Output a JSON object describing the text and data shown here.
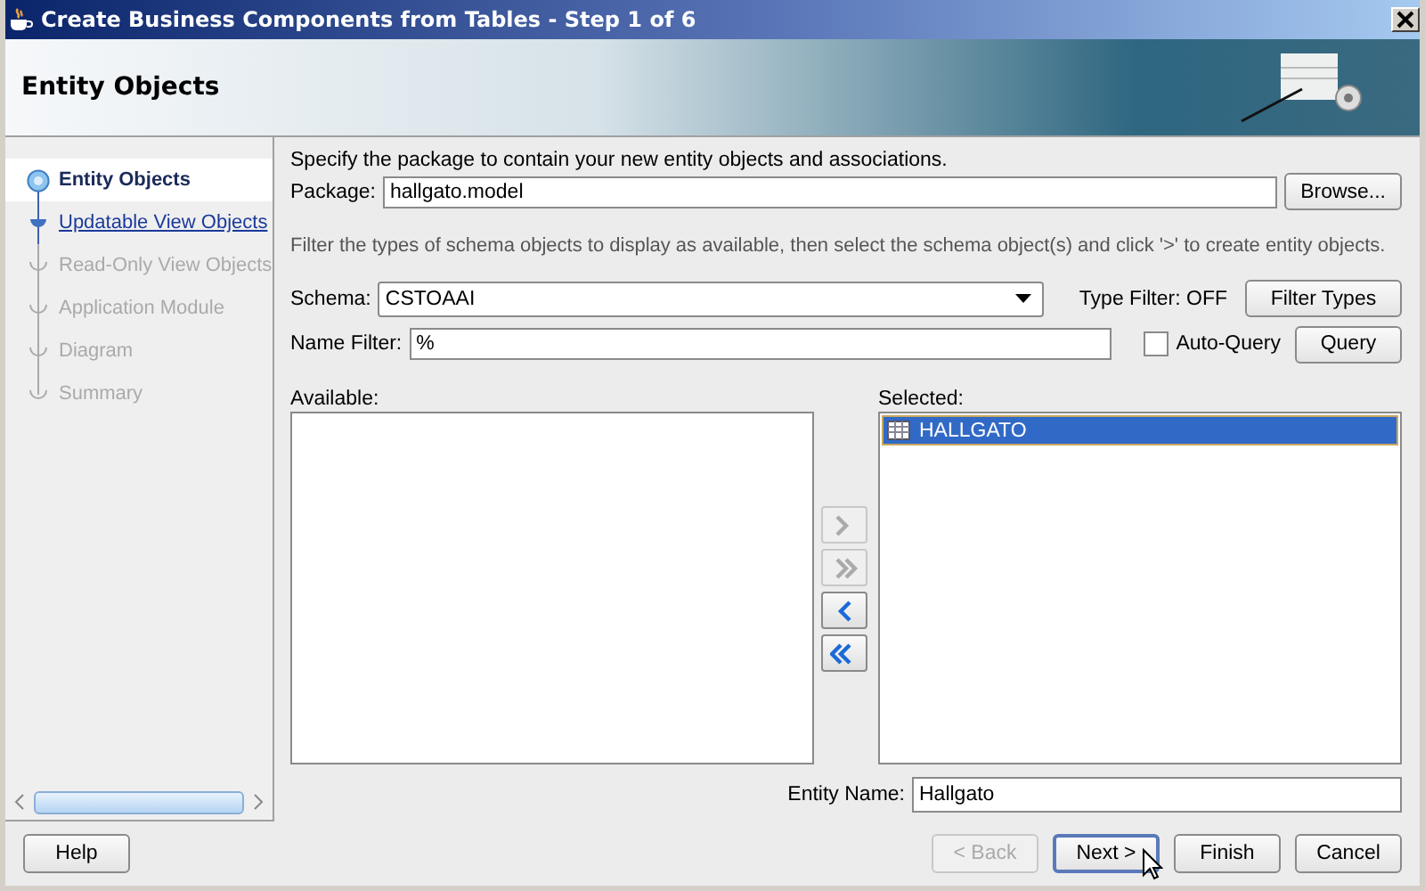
{
  "window": {
    "title": "Create Business Components from Tables - Step 1 of 6"
  },
  "header": {
    "title": "Entity Objects"
  },
  "steps": [
    {
      "label": "Entity Objects",
      "selected": true,
      "disabled": false
    },
    {
      "label": "Updatable View Objects",
      "selected": false,
      "disabled": false
    },
    {
      "label": "Read-Only View Objects",
      "selected": false,
      "disabled": true
    },
    {
      "label": "Application Module",
      "selected": false,
      "disabled": true
    },
    {
      "label": "Diagram",
      "selected": false,
      "disabled": true
    },
    {
      "label": "Summary",
      "selected": false,
      "disabled": true
    }
  ],
  "intro": "Specify the package to contain your new entity objects and associations.",
  "package": {
    "label": "Package:",
    "value": "hallgato.model",
    "button": "Browse..."
  },
  "filter_hint": "Filter the types of schema objects to display as available, then select the schema object(s) and click '>' to create entity objects.",
  "schema": {
    "label": "Schema:",
    "value": "CSTOAAI",
    "type_filter": "Type Filter: OFF",
    "button": "Filter Types"
  },
  "name_filter": {
    "label": "Name Filter:",
    "value": "%",
    "auto_query_label": "Auto-Query",
    "auto_query": false,
    "button": "Query"
  },
  "available": {
    "label": "Available:"
  },
  "shuttle": [
    {
      "kind": "add",
      "disabled": true
    },
    {
      "kind": "add_all",
      "disabled": true
    },
    {
      "kind": "remove",
      "disabled": false
    },
    {
      "kind": "remove_all",
      "disabled": false
    }
  ],
  "selected_list": {
    "label": "Selected:",
    "items": [
      {
        "name": "HALLGATO",
        "selected": true
      }
    ]
  },
  "entity_name": {
    "label": "Entity Name:",
    "value": "Hallgato"
  },
  "buttons": [
    {
      "label": "Help",
      "kind": "left",
      "disabled": false
    },
    {
      "label": "< Back",
      "kind": "right",
      "disabled": true
    },
    {
      "label": "Next >",
      "kind": "right",
      "disabled": false
    },
    {
      "label": "Finish",
      "kind": "right",
      "disabled": false
    },
    {
      "label": "Cancel",
      "kind": "right",
      "disabled": false
    }
  ]
}
